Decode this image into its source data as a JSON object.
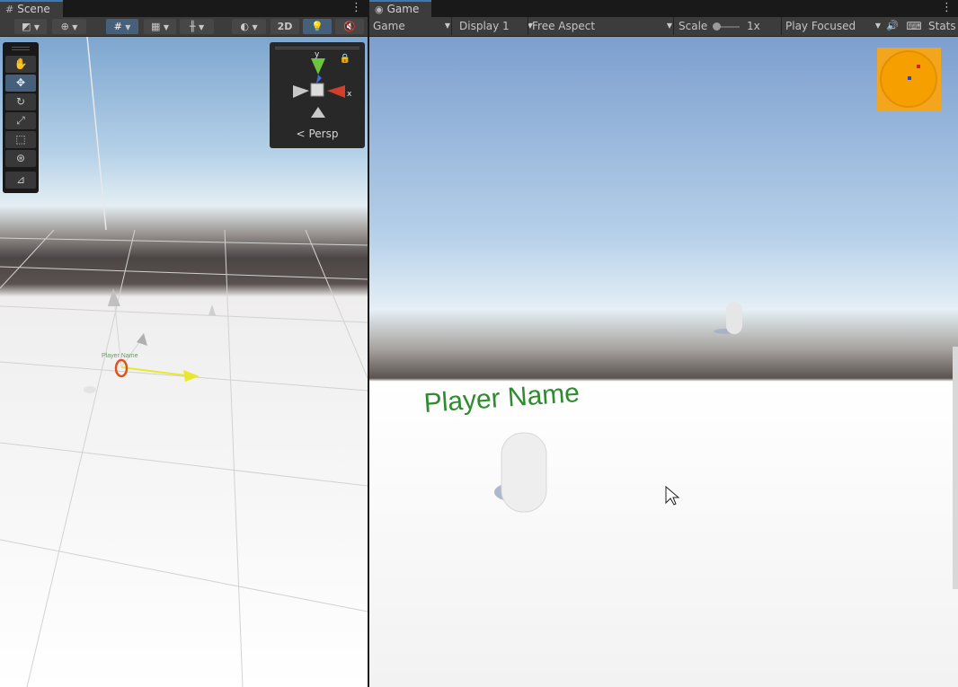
{
  "scene": {
    "tab_label": "Scene",
    "buttons": {
      "two_d": "2D"
    },
    "tools": [
      "hand-tool",
      "move-tool",
      "rotate-tool",
      "scale-tool",
      "rect-tool",
      "transform-tool",
      "custom-tool"
    ],
    "gizmo": {
      "x": "x",
      "y": "y",
      "persp": "Persp"
    },
    "object_label": "Player Name"
  },
  "game": {
    "tab_label": "Game",
    "mode": "Game",
    "display": "Display 1",
    "aspect": "Free Aspect",
    "scale_label": "Scale",
    "scale_value": "1x",
    "play_mode": "Play Focused",
    "stats": "Stats",
    "player_label": "Player Name"
  },
  "colors": {
    "accent": "#3a79bb",
    "player_label": "#2e8b2e",
    "minimap": "#f3a51e",
    "move_x": "#e8e82c",
    "pivot": "#e0521c"
  }
}
